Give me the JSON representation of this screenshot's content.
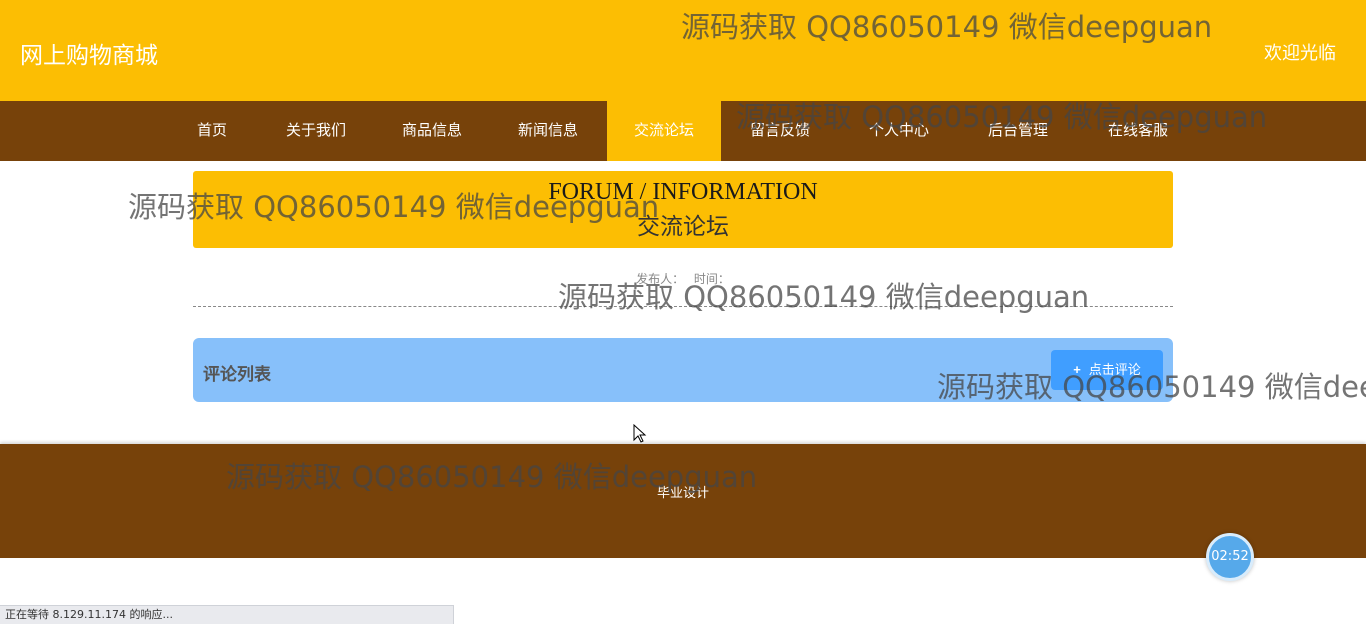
{
  "header": {
    "site_title": "网上购物商城",
    "welcome": "欢迎光临"
  },
  "nav": {
    "items": [
      {
        "label": "首页"
      },
      {
        "label": "关于我们"
      },
      {
        "label": "商品信息"
      },
      {
        "label": "新闻信息"
      },
      {
        "label": "交流论坛",
        "active": true
      },
      {
        "label": "留言反馈"
      },
      {
        "label": "个人中心"
      },
      {
        "label": "后台管理"
      },
      {
        "label": "在线客服"
      }
    ]
  },
  "banner": {
    "title_en": "FORUM / INFORMATION",
    "title_cn": "交流论坛"
  },
  "post_meta": {
    "publisher_label": "发布人：",
    "time_label": "时间："
  },
  "comments": {
    "title": "评论列表",
    "button_icon": "plus-icon",
    "button_label": "点击评论"
  },
  "footer": {
    "text": "毕业设计"
  },
  "watermark": {
    "text": "源码获取 QQ86050149 微信deepguan"
  },
  "timer": {
    "value": "02:52"
  },
  "status_bar": {
    "text": "正在等待 8.129.11.174 的响应..."
  },
  "colors": {
    "primary": "#fcbe03",
    "nav_bg": "#77420a",
    "comment_bar": "#87c0fa",
    "button": "#409eff"
  }
}
